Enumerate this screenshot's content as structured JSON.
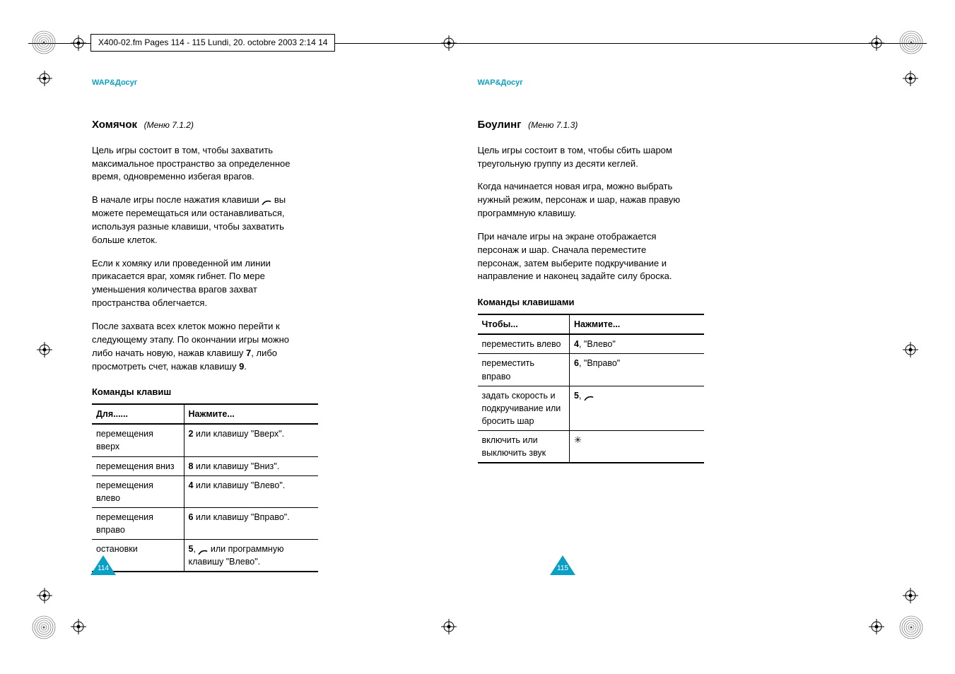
{
  "page_info": "X400-02.fm  Pages 114 - 115  Lundi, 20. octobre 2003  2:14 14",
  "left": {
    "section": "WAP&Досуг",
    "title": "Хомячок",
    "menu_ref": "(Меню 7.1.2)",
    "p1": "Цель игры состоит в том, чтобы захватить максимальное пространство за определенное время, одновременно избегая врагов.",
    "p2a": "В начале игры после нажатия клавиши ",
    "p2b": " вы можете перемещаться или останавливаться, используя разные клавиши, чтобы захватить больше клеток.",
    "p3": "Если к хомяку или проведенной им линии прикасается враг, хомяк гибнет. По мере уменьшения количества врагов захват пространства облегчается.",
    "p4a": "После захвата всех клеток можно перейти к следующему этапу. По окончании игры можно либо начать новую, нажав клавишу ",
    "p4b": ", либо просмотреть счет, нажав клавишу ",
    "p4c": ".",
    "key7": "7",
    "key9": "9",
    "table_title": "Команды клавиш",
    "col1": "Для......",
    "col2": "Нажмите...",
    "rows": [
      {
        "a": "перемещения вверх",
        "b1": "2",
        "b2": " или клавишу \"Вверх\"."
      },
      {
        "a": "перемещения вниз",
        "b1": "8",
        "b2": " или клавишу \"Вниз\"."
      },
      {
        "a": "перемещения влево",
        "b1": "4",
        "b2": " или клавишу \"Влево\"."
      },
      {
        "a": "перемещения вправо",
        "b1": "6",
        "b2": " или клавишу \"Вправо\"."
      },
      {
        "a": "остановки",
        "b1": "5",
        "b2": " или программную клавишу \"Влево\"."
      }
    ],
    "page_num": "114"
  },
  "right": {
    "section": "WAP&Досуг",
    "title": "Боулинг",
    "menu_ref": "(Меню 7.1.3)",
    "p1": "Цель игры состоит в том, чтобы сбить шаром треугольную группу из десяти кеглей.",
    "p2": "Когда начинается новая игра, можно выбрать нужный режим, персонаж и шар, нажав правую программную клавишу.",
    "p3": "При начале игры на экране отображается персонаж и шар. Сначала переместите персонаж, затем выберите подкручивание и направление и наконец задайте силу броска.",
    "table_title": "Команды клавишами",
    "col1": "Чтобы...",
    "col2": "Нажмите...",
    "rows": [
      {
        "a": "переместить влево",
        "b1": "4",
        "b2": ", \"Влево\""
      },
      {
        "a": "переместить вправо",
        "b1": "6",
        "b2": ", \"Вправо\""
      },
      {
        "a": "задать скорость и подкручивание или бросить шар",
        "b1": "5",
        "b2": ", ",
        "icon": "phone"
      },
      {
        "a": "включить или выключить звук",
        "icon_only": "star"
      }
    ],
    "page_num": "115"
  }
}
